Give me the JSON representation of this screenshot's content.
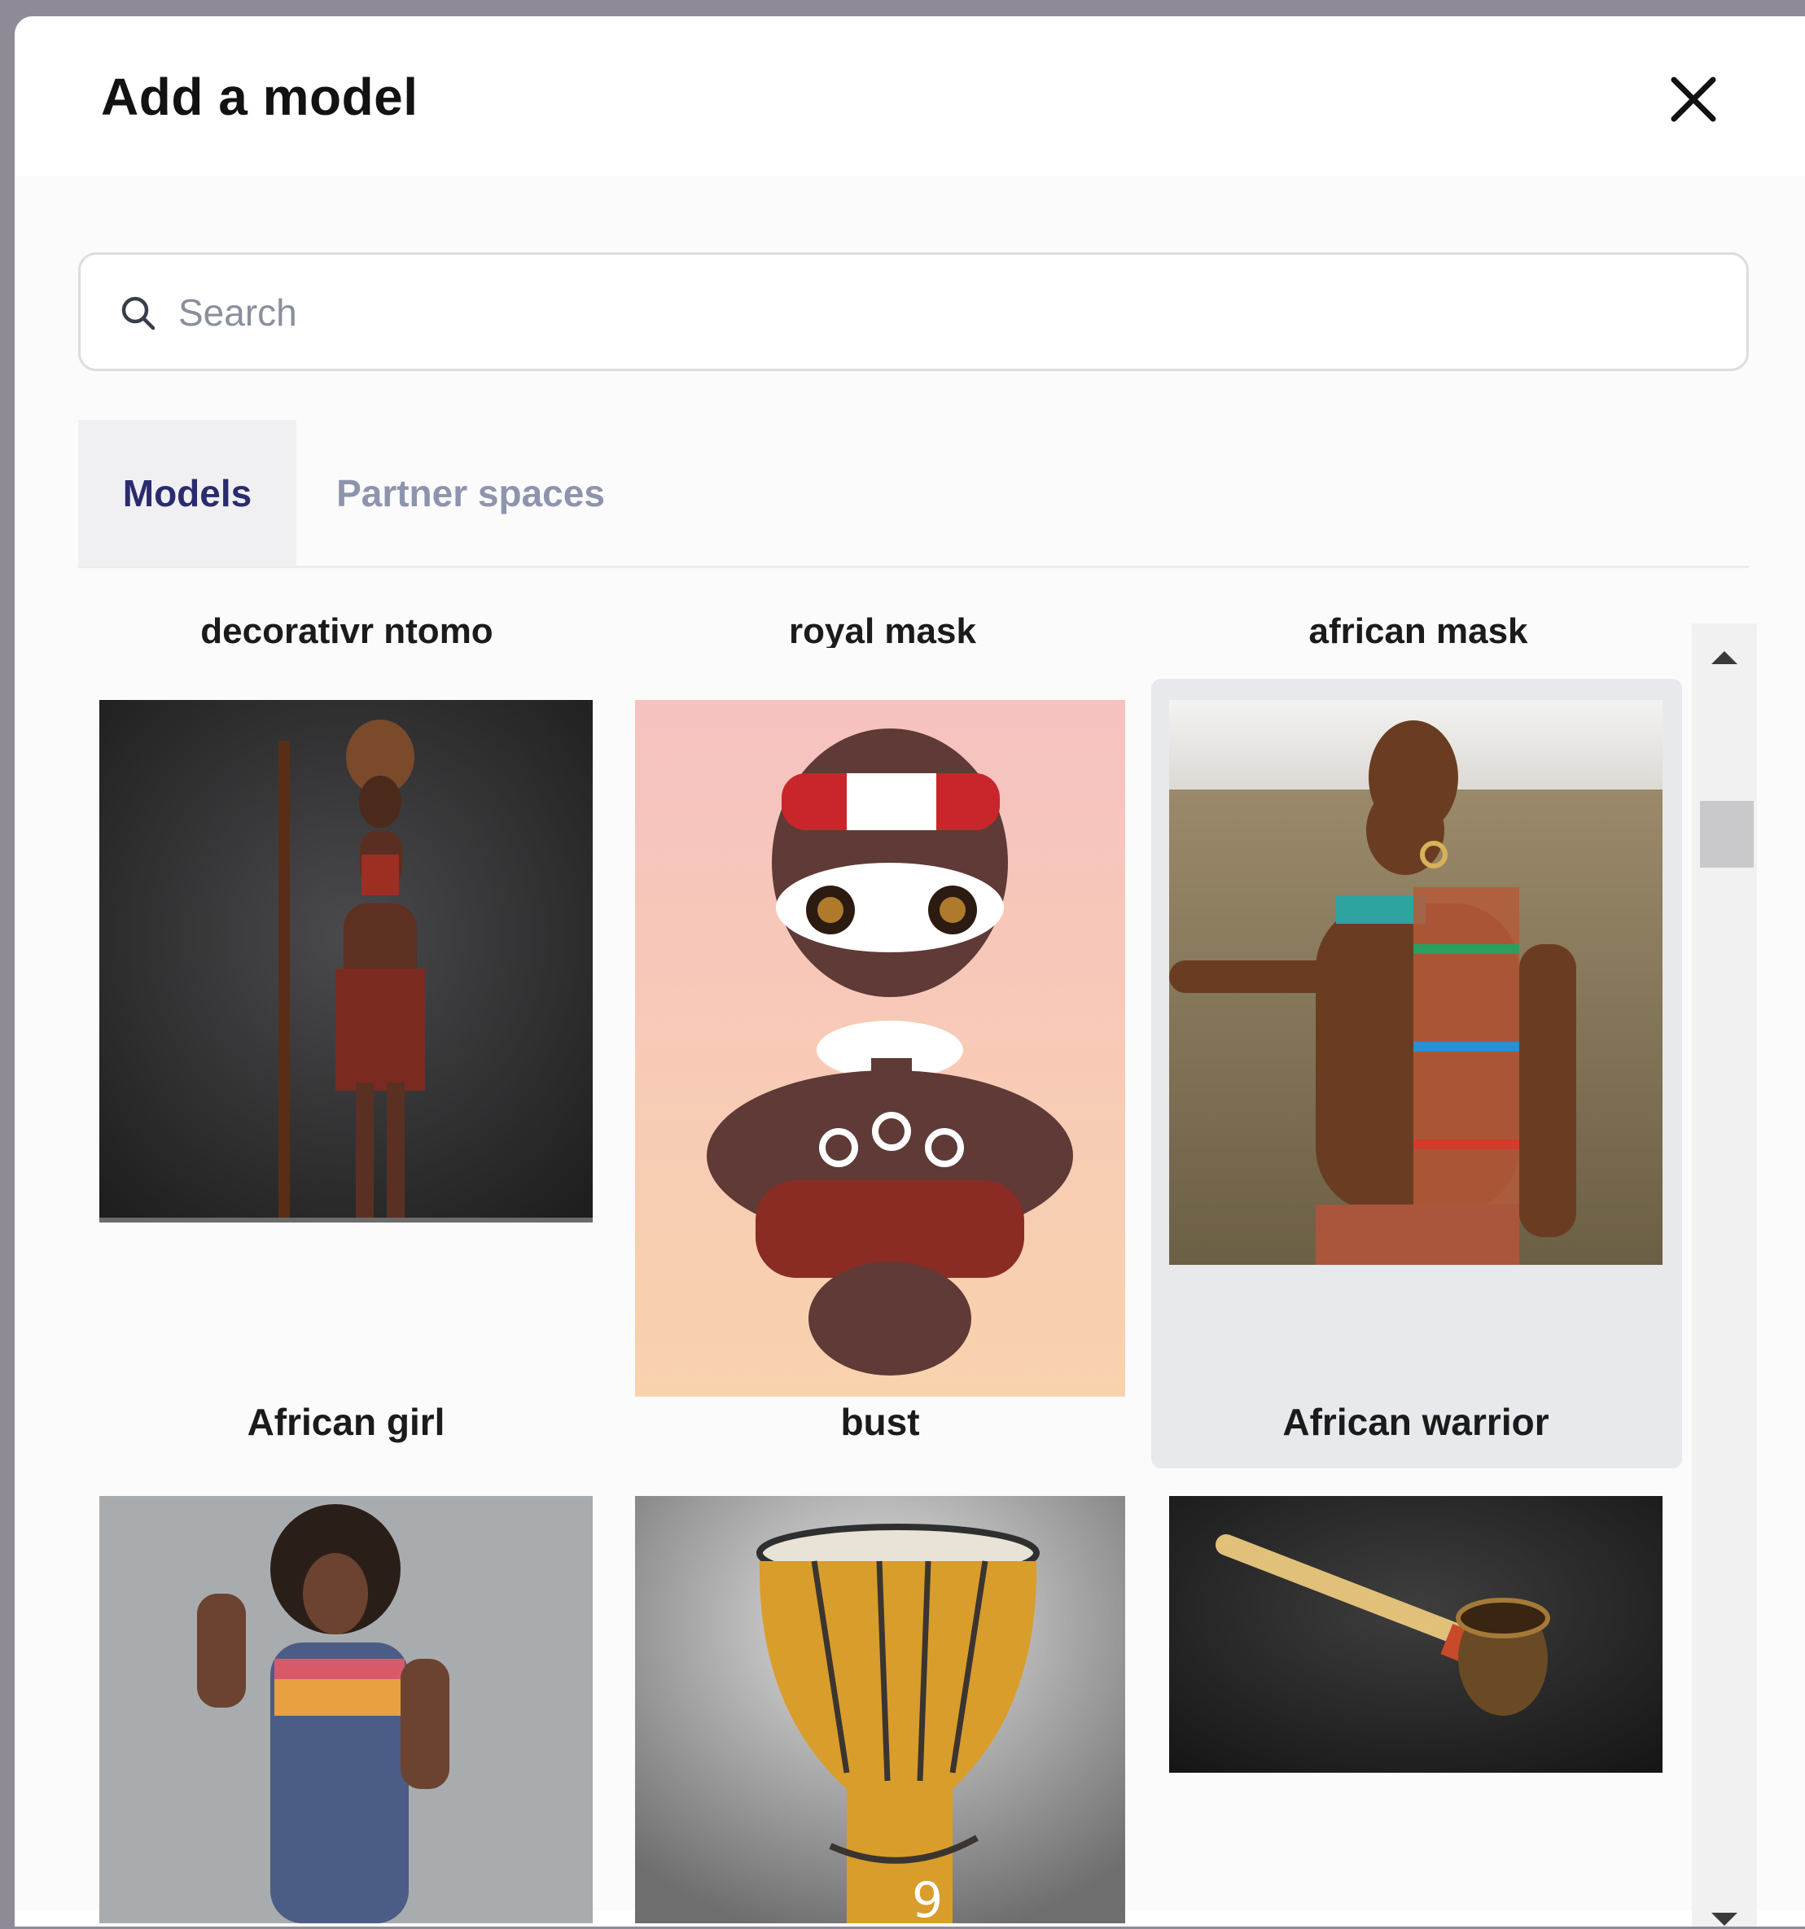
{
  "dialog": {
    "title": "Add a model",
    "close_icon": "close-icon"
  },
  "search": {
    "placeholder": "Search",
    "value": "",
    "icon": "search-icon"
  },
  "tabs": [
    {
      "label": "Models",
      "active": true
    },
    {
      "label": "Partner spaces",
      "active": false
    }
  ],
  "models": {
    "row0_labels": [
      "decorativr ntomo",
      "royal mask",
      "african mask"
    ],
    "row1": [
      {
        "label": "African girl"
      },
      {
        "label": "bust"
      },
      {
        "label": "African warrior",
        "selected": true
      }
    ],
    "row2": [
      {
        "label": ""
      },
      {
        "label": ""
      },
      {
        "label": ""
      }
    ]
  },
  "overlay": {
    "page_number": "9"
  },
  "colors": {
    "accent": "#2a2b6e",
    "tab_inactive": "#8e94ad",
    "selected_card_bg": "#e8e9ec"
  }
}
